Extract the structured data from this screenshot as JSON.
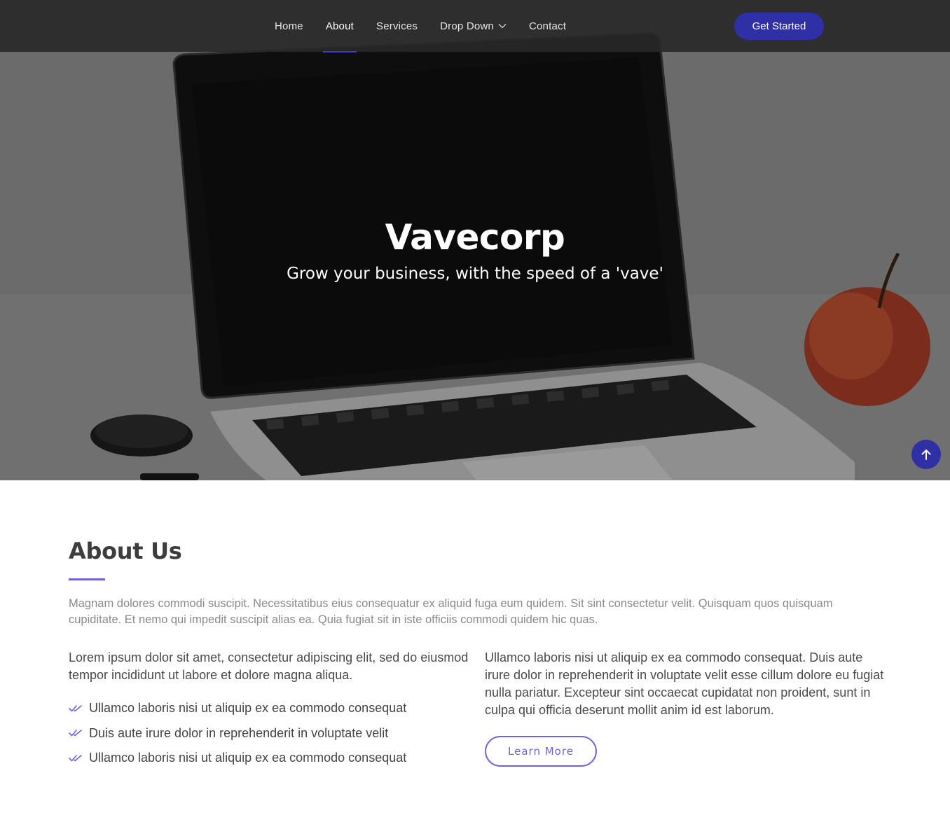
{
  "header": {
    "nav": [
      {
        "label": "Home"
      },
      {
        "label": "About"
      },
      {
        "label": "Services"
      },
      {
        "label": "Drop Down"
      },
      {
        "label": "Contact"
      }
    ],
    "active_index": 1,
    "cta_label": "Get Started"
  },
  "hero": {
    "title": "Vavecorp",
    "subtitle": "Grow your business, with the speed of a 'vave'"
  },
  "about": {
    "title": "About Us",
    "intro": "Magnam dolores commodi suscipit. Necessitatibus eius consequatur ex aliquid fuga eum quidem. Sit sint consectetur velit. Quisquam quos quisquam cupiditate. Et nemo qui impedit suscipit alias ea. Quia fugiat sit in iste officiis commodi quidem hic quas.",
    "left_paragraph": "Lorem ipsum dolor sit amet, consectetur adipiscing elit, sed do eiusmod tempor incididunt ut labore et dolore magna aliqua.",
    "checklist": [
      "Ullamco laboris nisi ut aliquip ex ea commodo consequat",
      "Duis aute irure dolor in reprehenderit in voluptate velit",
      "Ullamco laboris nisi ut aliquip ex ea commodo consequat"
    ],
    "right_paragraph": "Ullamco laboris nisi ut aliquip ex ea commodo consequat. Duis aute irure dolor in reprehenderit in voluptate velit esse cillum dolore eu fugiat nulla pariatur. Excepteur sint occaecat cupidatat non proident, sunt in culpa qui officia deserunt mollit anim id est laborum.",
    "learn_more_label": "Learn More"
  },
  "colors": {
    "accent": "#2f2fa6",
    "accent_light": "#6c63d6",
    "header_bg": "#282828"
  },
  "icons": {
    "dropdown": "chevron-down-icon",
    "checklist": "double-check-icon",
    "back_to_top": "arrow-up-icon"
  }
}
